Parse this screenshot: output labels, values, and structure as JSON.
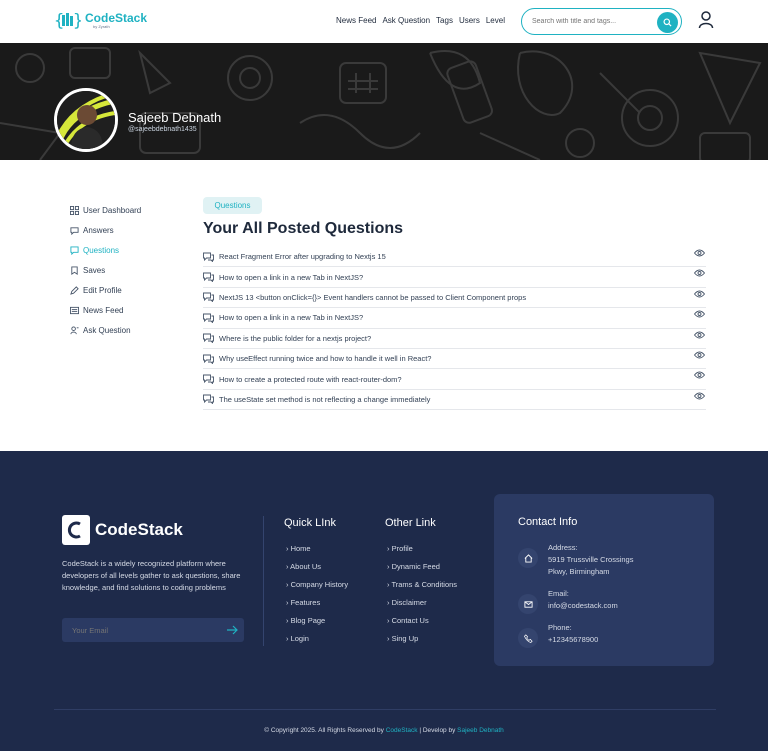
{
  "header": {
    "brand": "CodeStack",
    "brand_sub": "by Zyrath",
    "nav": [
      "News Feed",
      "Ask Question",
      "Tags",
      "Users",
      "Level"
    ],
    "search_placeholder": "Search with title and tags..."
  },
  "profile": {
    "name": "Sajeeb Debnath",
    "handle": "@sajeebdebnath1435"
  },
  "sidebar": {
    "items": [
      {
        "label": "User Dashboard",
        "icon": "dashboard-icon"
      },
      {
        "label": "Answers",
        "icon": "chat-icon"
      },
      {
        "label": "Questions",
        "icon": "question-icon",
        "active": true
      },
      {
        "label": "Saves",
        "icon": "bookmark-icon"
      },
      {
        "label": "Edit Profile",
        "icon": "edit-icon"
      },
      {
        "label": "News Feed",
        "icon": "newspaper-icon"
      },
      {
        "label": "Ask Question",
        "icon": "user-ask-icon"
      }
    ]
  },
  "main": {
    "tab_chip": "Questions",
    "title": "Your All Posted Questions",
    "questions": [
      "React Fragment Error after upgrading to Nextjs 15",
      "How to open a link in a new Tab in NextJS?",
      "NextJS 13 <button onClick={}> Event handlers cannot be passed to Client Component props",
      "How to open a link in a new Tab in NextJS?",
      "Where is the public folder for a nextjs project?",
      "Why useEffect running twice and how to handle it well in React?",
      "How to create a protected route with react-router-dom?",
      "The useState set method is not reflecting a change immediately"
    ]
  },
  "footer": {
    "brand": "CodeStack",
    "description": "CodeStack is a widely recognized platform where developers of all levels gather to ask questions, share knowledge, and find solutions to coding problems",
    "email_placeholder": "Your Email",
    "quick_link_title": "Quick LInk",
    "quick_links": [
      "Home",
      "About Us",
      "Company History",
      "Features",
      "Blog Page",
      "Login"
    ],
    "other_link_title": "Other Link",
    "other_links": [
      "Profile",
      "Dynamic Feed",
      "Trams & Conditions",
      "Disclaimer",
      "Contact Us",
      "Sing Up"
    ],
    "contact_title": "Contact Info",
    "address_label": "Address:",
    "address_line1": "5919 Trussville Crossings",
    "address_line2": "Pkwy, Birmingham",
    "email_label": "Email:",
    "email_value": "info@codestack.com",
    "phone_label": "Phone:",
    "phone_value": "+12345678900",
    "copyright_prefix": "© Copyright 2025. All Rights Reserved by",
    "copyright_brand": "CodeStack",
    "copyright_mid": "| Develop by",
    "copyright_dev": "Sajeeb Debnath"
  },
  "colors": {
    "accent": "#1fb2c2",
    "footer_bg": "#1e2a4a",
    "banner_bg": "#1a1a1a"
  }
}
